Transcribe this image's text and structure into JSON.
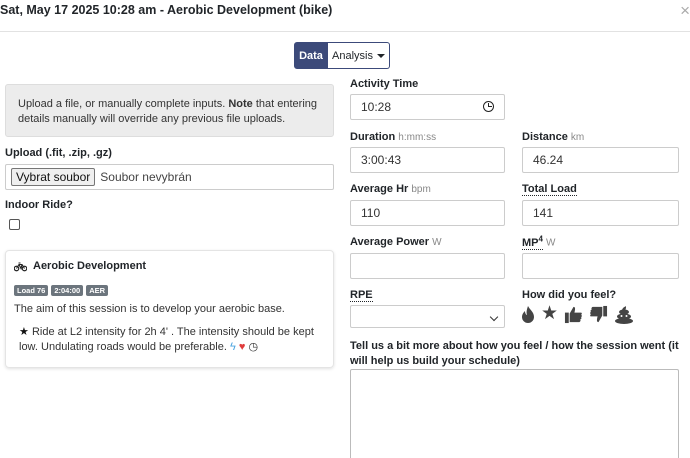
{
  "header": {
    "title": "Sat, May 17 2025 10:28 am - Aerobic Development (bike)",
    "close": "×"
  },
  "toggle": {
    "data_label": "Data",
    "analysis_label": "Analysis"
  },
  "upload": {
    "info_prefix": "Upload a file, or manually complete inputs.",
    "info_note": "Note",
    "info_suffix": "that entering details manually will override any previous file uploads.",
    "label": "Upload (.fit, .zip, .gz)",
    "button": "Vybrat soubor",
    "status": "Soubor nevybrán"
  },
  "indoor": {
    "label": "Indoor Ride?",
    "checked": false
  },
  "workout": {
    "title": "Aerobic Development",
    "badges": [
      "Load 76",
      "2:04:00",
      "AER"
    ],
    "aim": "The aim of this session is to develop your aerobic base.",
    "desc": "Ride at L2 intensity for 2h 4' . The intensity should be kept low. Undulating roads would be preferable."
  },
  "form": {
    "activity_time": {
      "label": "Activity Time",
      "value": "10:28"
    },
    "duration": {
      "label": "Duration",
      "unit": "h:mm:ss",
      "value": "3:00:43"
    },
    "distance": {
      "label": "Distance",
      "unit": "km",
      "value": "46.24"
    },
    "avg_hr": {
      "label": "Average Hr",
      "unit": "bpm",
      "value": "110"
    },
    "total_load": {
      "label": "Total Load",
      "value": "141"
    },
    "avg_power": {
      "label": "Average Power",
      "unit": "W",
      "value": ""
    },
    "mp4": {
      "label": "MP",
      "sup": "4",
      "unit": "W",
      "value": ""
    },
    "rpe": {
      "label": "RPE",
      "value": ""
    },
    "feel": {
      "label": "How did you feel?"
    },
    "tell": {
      "label": "Tell us a bit more about how you feel / how the session went (it will help us build your schedule)",
      "value": ""
    }
  }
}
